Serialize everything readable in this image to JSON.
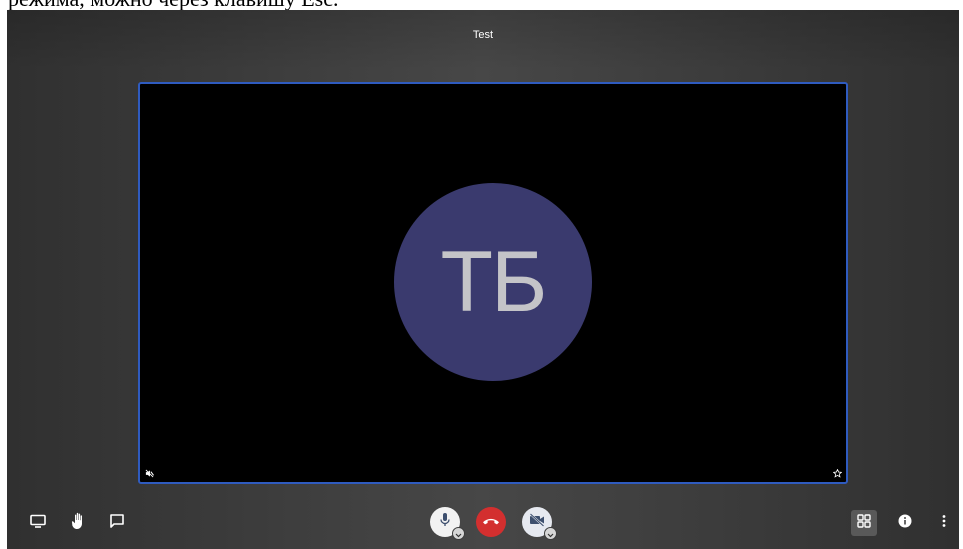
{
  "document": {
    "caption_fragment": "режима, можно через клавишу Esc."
  },
  "meeting": {
    "title": "Test"
  },
  "participant": {
    "initials": "ТБ",
    "avatar_color": "#3a3a6e",
    "status_icons": [
      "audio-muted-icon",
      "star-icon"
    ]
  },
  "toolbar": {
    "left": [
      "screen-share-icon",
      "raise-hand-icon",
      "chat-icon"
    ],
    "center": [
      "microphone-icon",
      "hangup-icon",
      "camera-off-icon"
    ],
    "right": [
      "tile-view-icon",
      "info-icon",
      "more-options-icon"
    ],
    "hangup_color": "#d32f2f",
    "tile_border_color": "#2f5bbf"
  }
}
